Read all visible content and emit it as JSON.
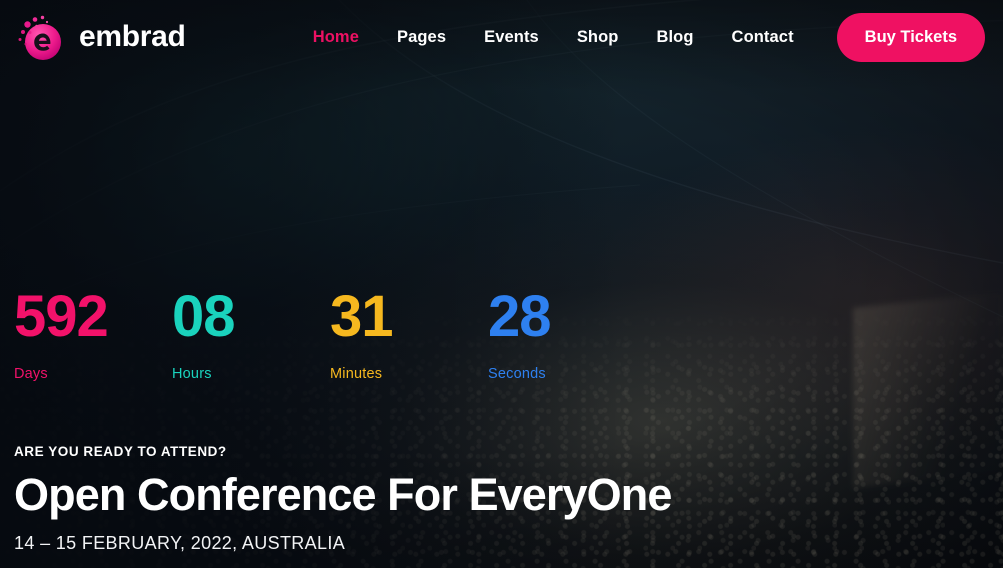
{
  "brand": {
    "name": "embrad",
    "logo_icon": "embrad-e-particle-logo",
    "logo_color_start": "#ff49a8",
    "logo_color_end": "#d6007f"
  },
  "nav": {
    "items": [
      {
        "label": "Home",
        "active": true
      },
      {
        "label": "Pages",
        "active": false
      },
      {
        "label": "Events",
        "active": false
      },
      {
        "label": "Shop",
        "active": false
      },
      {
        "label": "Blog",
        "active": false
      },
      {
        "label": "Contact",
        "active": false
      }
    ],
    "active_color": "#ec1163",
    "cta": {
      "label": "Buy Tickets",
      "color": "#ef1162"
    }
  },
  "countdown": {
    "units": [
      {
        "value": "592",
        "label": "Days",
        "color": "#f2126a"
      },
      {
        "value": "08",
        "label": "Hours",
        "color": "#1ad3bd"
      },
      {
        "value": "31",
        "label": "Minutes",
        "color": "#f6b81f"
      },
      {
        "value": "28",
        "label": "Seconds",
        "color": "#2e80f0"
      }
    ]
  },
  "hero": {
    "kicker": "Are You Ready To Attend?",
    "title": "Open Conference For EveryOne",
    "date": "14 – 15 February, 2022, Australia"
  }
}
